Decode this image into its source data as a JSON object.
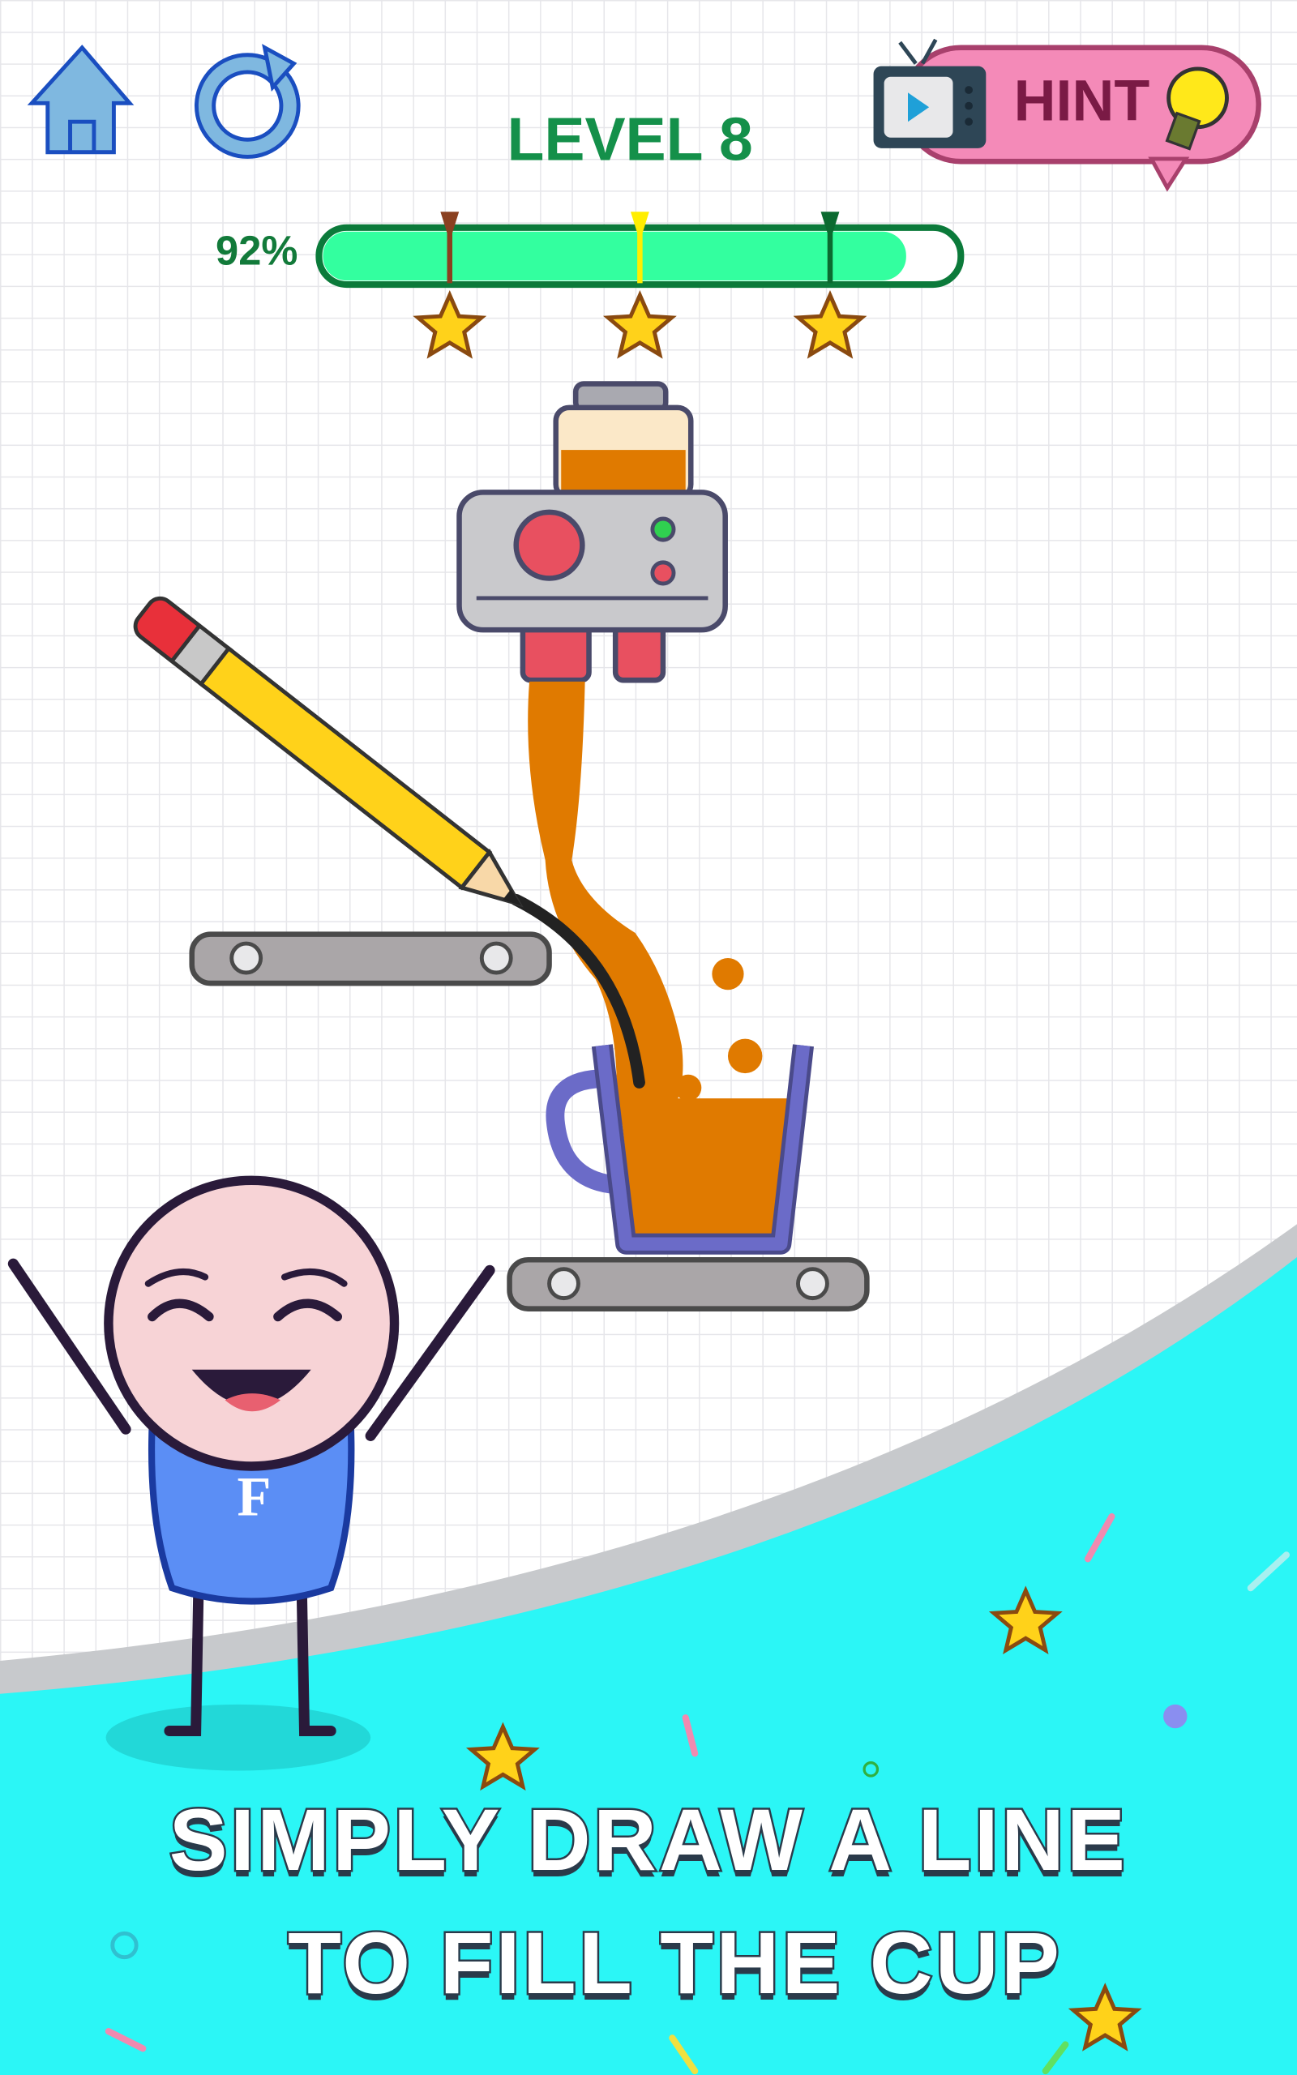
{
  "header": {
    "level_label": "LEVEL 8",
    "hint_label": "HINT",
    "home_icon": "home-icon",
    "restart_icon": "restart-icon"
  },
  "progress": {
    "percent_label": "92%",
    "value": 0.92,
    "star_thresholds": [
      0.2,
      0.5,
      0.8
    ],
    "colors": {
      "fill": "#33ff9f",
      "border": "#0b7a3a"
    }
  },
  "tagline": {
    "line1": "SIMPLY DRAW A LINE",
    "line2": "TO FILL THE CUP"
  },
  "character": {
    "shirt_letter": "F"
  },
  "colors": {
    "cyan": "#2bf6f6",
    "liquid": "#e07a00",
    "cup": "#6b6bc8"
  }
}
